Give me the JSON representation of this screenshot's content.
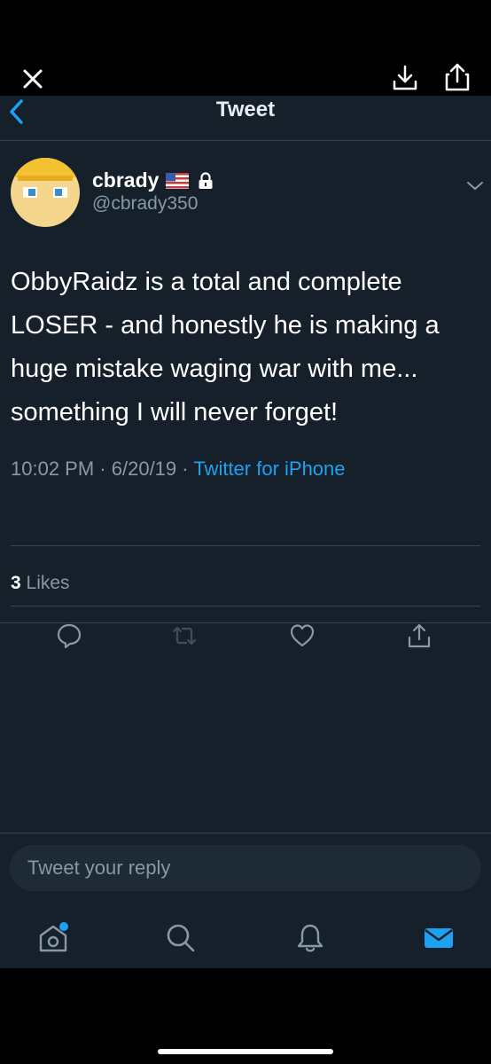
{
  "viewer": {
    "close_icon": "close-icon",
    "download_icon": "download-icon",
    "share_icon": "share-icon"
  },
  "navbar": {
    "title": "Tweet",
    "back_icon": "chevron-left-icon"
  },
  "tweet": {
    "display_name": "cbrady",
    "handle": "@cbrady350",
    "text": "ObbyRaidz is a total and complete LOSER - and honestly he is making a huge mistake waging war with me... something I will never forget!",
    "time": "10:02 PM",
    "date": "6/20/19",
    "separator": "·",
    "source": "Twitter for iPhone",
    "likes_count": "3",
    "likes_label": "Likes"
  },
  "reply": {
    "placeholder": "Tweet your reply"
  },
  "tabs": [
    "home-icon",
    "search-icon",
    "notifications-icon",
    "messages-icon"
  ],
  "colors": {
    "background": "#15202b",
    "accent": "#1da1f2",
    "secondary_text": "#8899a6",
    "divider": "#38444d"
  }
}
